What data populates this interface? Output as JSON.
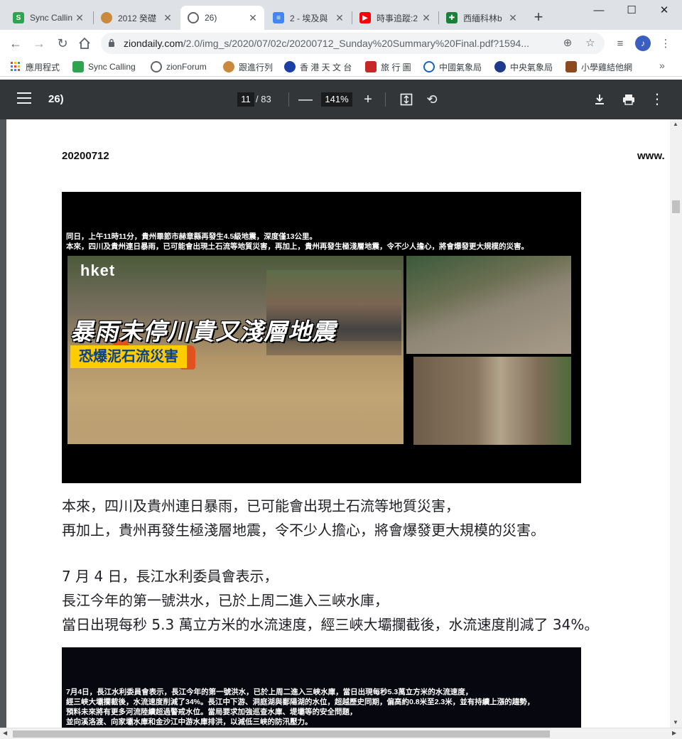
{
  "browser": {
    "tabs": [
      {
        "title": "Sync Callin",
        "favicon": "sync-calling-icon",
        "color": "#2ea44f"
      },
      {
        "title": "2012 癸礎",
        "favicon": "cookie-icon",
        "color": "#c98a3b"
      },
      {
        "title": "26)",
        "favicon": "globe-icon",
        "color": "#5f6368"
      },
      {
        "title": "2 - 埃及與",
        "favicon": "docs-icon",
        "color": "#4285f4"
      },
      {
        "title": "時事追蹤:2",
        "favicon": "youtube-icon",
        "color": "#ff0000"
      },
      {
        "title": "西緬科林b",
        "favicon": "plus-cross-icon",
        "color": "#188038"
      }
    ],
    "active_tab_index": 2,
    "new_tab_label": "+",
    "window": {
      "minimize": "—",
      "maximize": "☐",
      "close": "✕"
    },
    "url_host": "ziondaily.com",
    "url_path": "/2.0/img_s/2020/07/02c/20200712_Sunday%20Summary%20Final.pdf?1594...",
    "profile_initial": "♪",
    "bookmarks": [
      {
        "label": "應用程式",
        "icon": "apps-grid-icon",
        "color": "#ea4335"
      },
      {
        "label": "Sync Calling",
        "icon": "sync-calling-icon",
        "color": "#2ea44f"
      },
      {
        "label": "zionForum",
        "icon": "globe-icon",
        "color": "#5f6368"
      },
      {
        "label": "跟進行列",
        "icon": "cookie-icon",
        "color": "#c98a3b"
      },
      {
        "label": "香 港 天 文 台",
        "icon": "observatory-icon",
        "color": "#1a3fa6"
      },
      {
        "label": "旅 行 圖",
        "icon": "travel-map-icon",
        "color": "#c62828"
      },
      {
        "label": "中國氣象局",
        "icon": "weather-cma-icon",
        "color": "#1565c0"
      },
      {
        "label": "中央氣象局",
        "icon": "weather-cwb-icon",
        "color": "#1e3a8a"
      },
      {
        "label": "小學雞結他網",
        "icon": "guitar-icon",
        "color": "#8d4a1f"
      }
    ]
  },
  "pdf": {
    "title": "26)",
    "current_page": "11",
    "page_separator": "/",
    "total_pages": "83",
    "zoom": "141%",
    "zoom_out": "—",
    "zoom_in": "+"
  },
  "document": {
    "date": "20200712",
    "site_fragment": "www.",
    "image1": {
      "caption_line1": "同日，上午11時11分，貴州畢節市赫章縣再發生4.5級地震，深度僅13公里。",
      "caption_line2": "本來，四川及貴州連日暴雨，已可能會出現土石流等地質災害，再加上，貴州再發生極淺層地震，令不少人擔心，將會爆發更大規模的災害。",
      "logo": "hket",
      "headline": "暴雨未停川貴又淺層地震",
      "subhead": "恐爆泥石流災害"
    },
    "paragraph1": [
      "本來，四川及貴州連日暴雨，已可能會出現土石流等地質災害，",
      "再加上，貴州再發生極淺層地震，令不少人擔心，將會爆發更大規模的災害。"
    ],
    "paragraph2": [
      "7 月 4 日，長江水利委員會表示，",
      "長江今年的第一號洪水，已於上周二進入三峽水庫，",
      "當日出現每秒 5.3 萬立方米的水流速度，經三峽大壩攔截後，水流速度削減了 34%。"
    ],
    "image2": {
      "caption_line1": "7月4日，長江水利委員會表示，長江今年的第一號洪水，已於上周二進入三峽水庫，當日出現每秒5.3萬立方米的水流速度，",
      "caption_line2": "經三峽大壩攔截後，水流速度削減了34%。長江中下游、洞庭湖與鄱陽湖的水位，超越歷史同期，偏高約0.8米至2.3米，並有持續上漲的趨勢，",
      "caption_line3": "預料未來將有更多河流陸續超過警戒水位。當局要求加強巡查水庫、堤壩等的安全問題，",
      "caption_line4": "並向溪洛渡、向家壩水庫和金沙江中游水庫排洪，以減低三峽的防汛壓力。"
    }
  }
}
